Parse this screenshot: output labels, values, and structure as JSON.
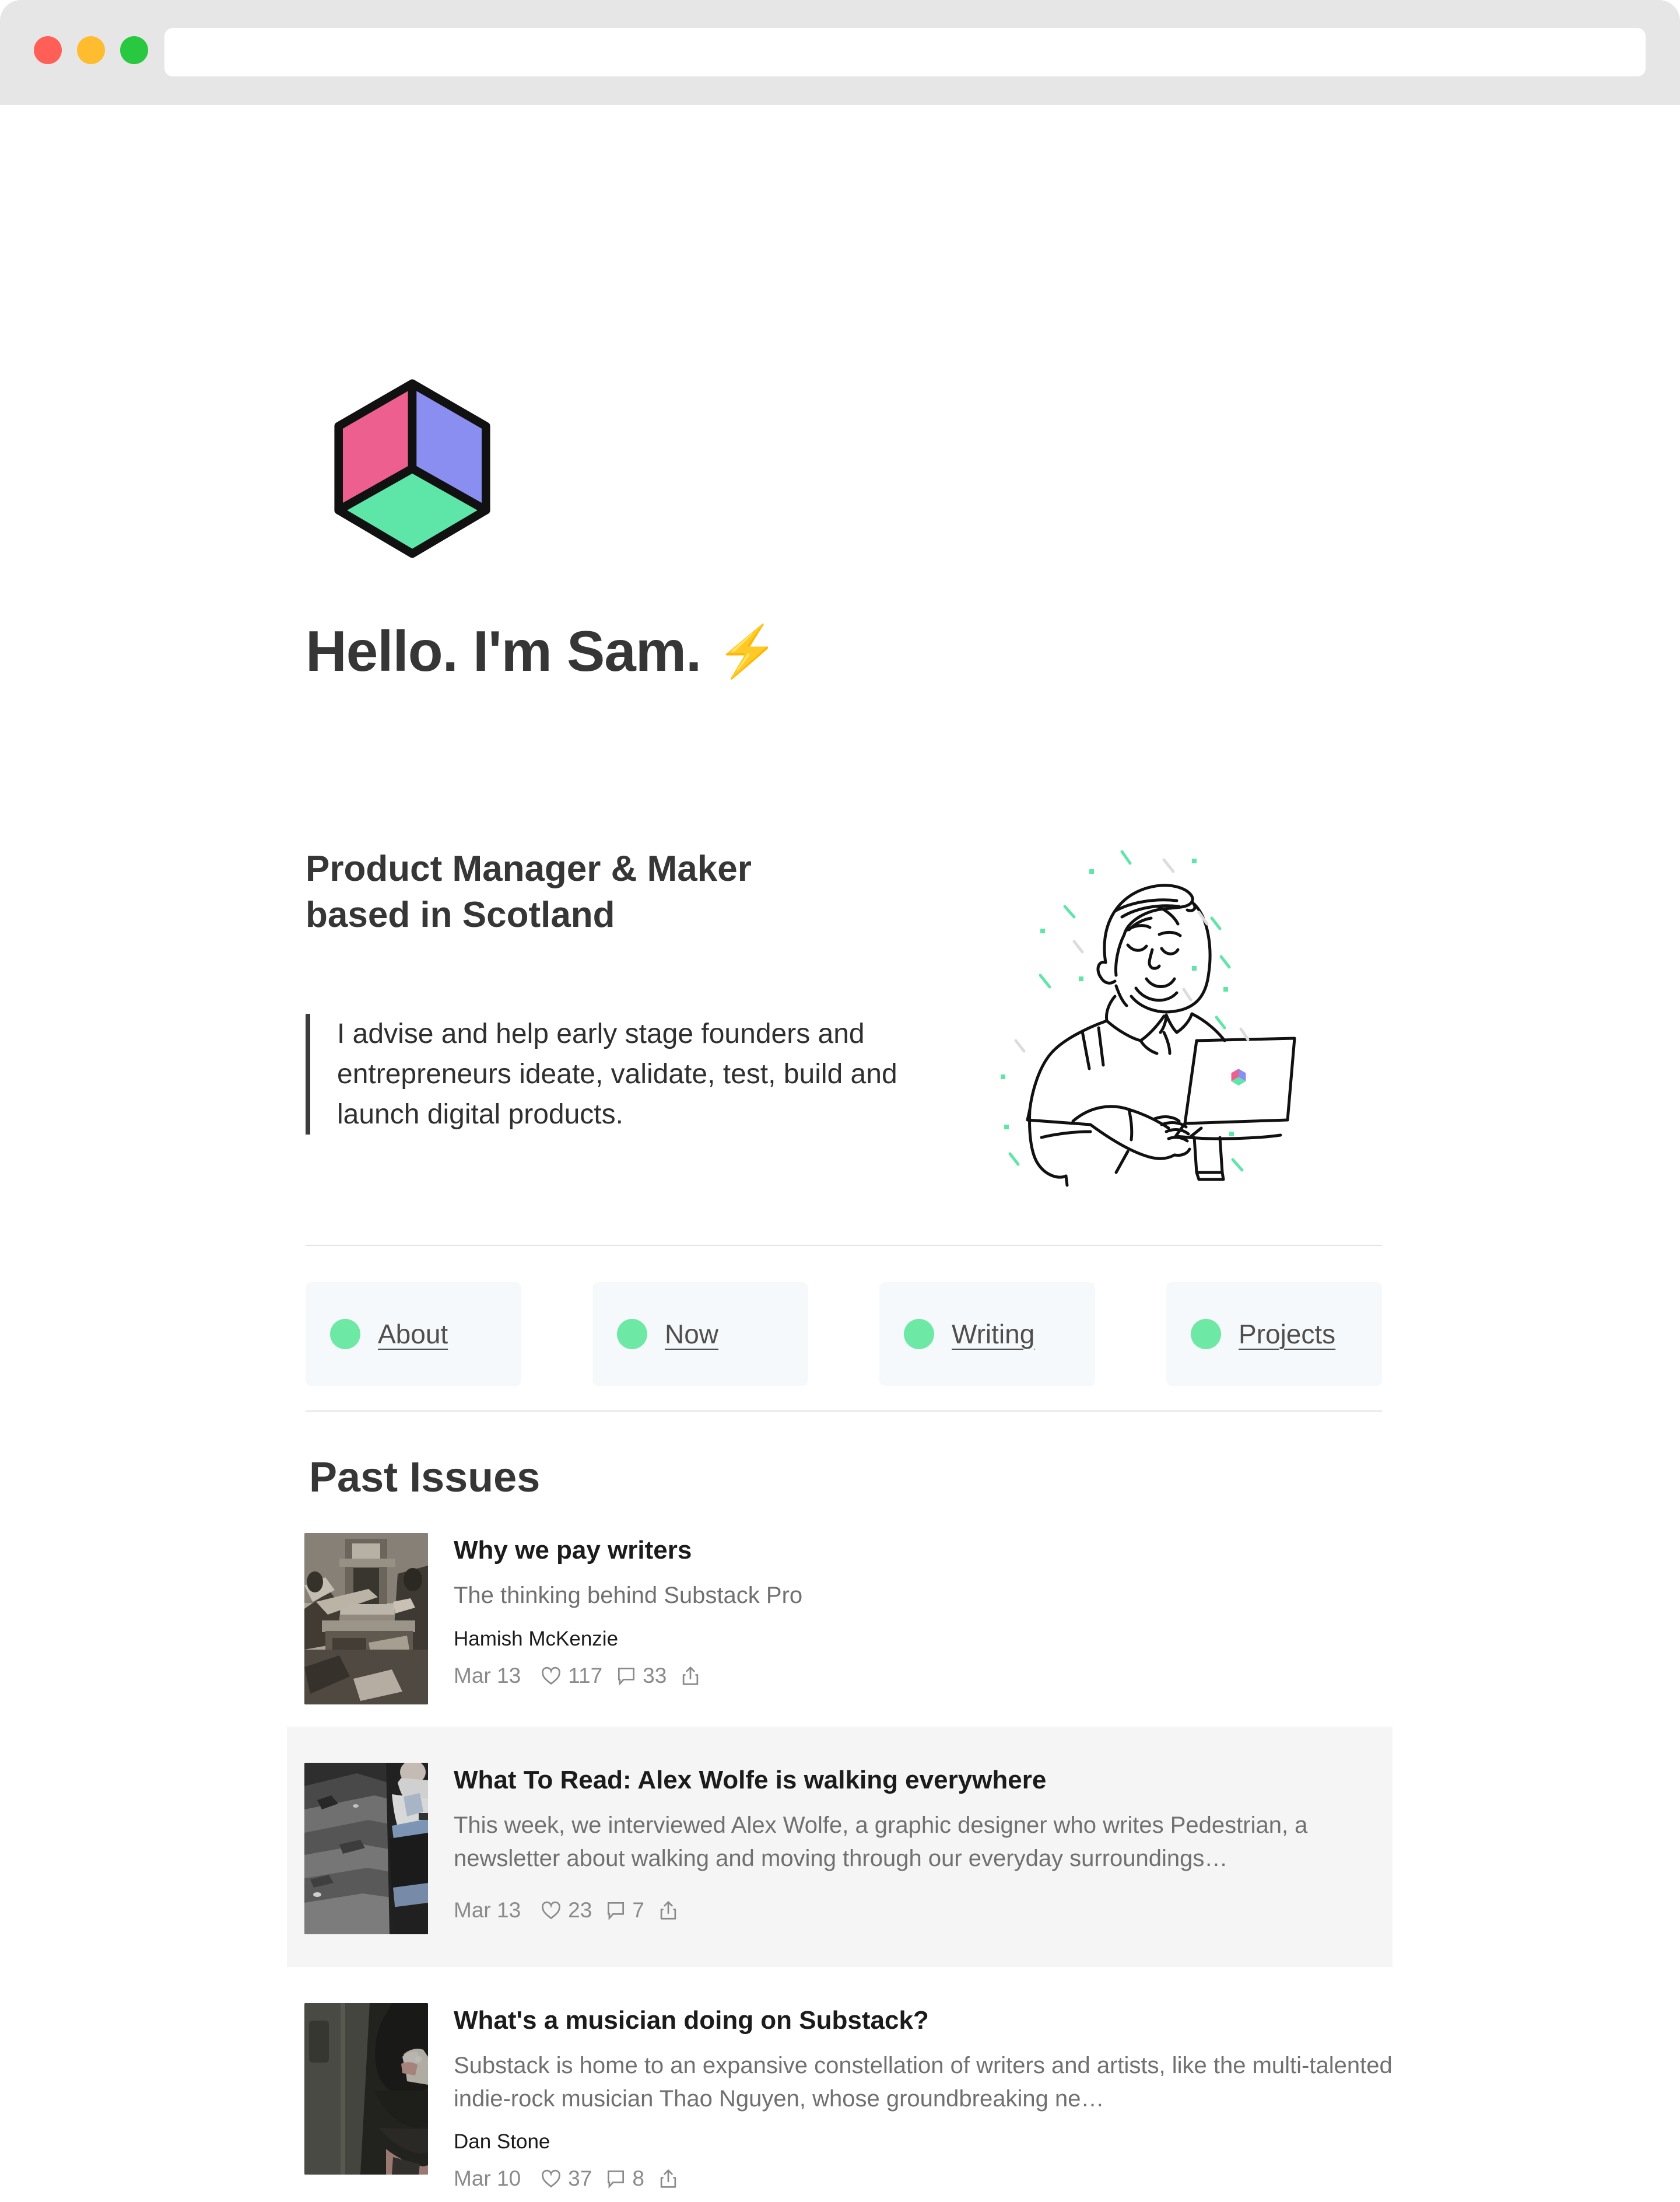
{
  "browser": {
    "traffic_lights": [
      "close",
      "minimize",
      "zoom"
    ],
    "url_value": "",
    "url_placeholder": ""
  },
  "hero": {
    "logo_name": "cube-logo",
    "logo_colors": {
      "left": "#ec5f8e",
      "right": "#8a8ef0",
      "bottom": "#5ee6a8",
      "outline": "#111111"
    },
    "headline": "Hello. I'm Sam.",
    "headline_emoji": "⚡",
    "subtitle_line1": "Product Manager & Maker",
    "subtitle_line2": "based in Scotland",
    "blockquote": "I advise and help early stage founders and entrepreneurs ideate, validate, test, build and launch digital products.",
    "illustration_name": "man-with-laptop-illustration",
    "banner_gradient": "#8fc4ae"
  },
  "nav": {
    "accent_color": "#6de8a5",
    "card_bg": "#f6f9fb",
    "items": [
      {
        "label": "About",
        "name": "nav-card-about"
      },
      {
        "label": "Now",
        "name": "nav-card-now"
      },
      {
        "label": "Writing",
        "name": "nav-card-writing"
      },
      {
        "label": "Projects",
        "name": "nav-card-projects"
      }
    ]
  },
  "past_issues": {
    "title": "Past Issues",
    "posts": [
      {
        "title": "Why we pay writers",
        "subtitle": "The thinking behind Substack Pro",
        "author": "Hamish McKenzie",
        "date": "Mar 13",
        "likes": "117",
        "comments": "33",
        "thumb_name": "printing-press-engraving-thumbnail",
        "highlighted": false
      },
      {
        "title": "What To Read: Alex Wolfe is walking everywhere",
        "subtitle": "This week, we interviewed Alex Wolfe, a graphic designer who writes Pedestrian, a newsletter about walking and moving through our everyday surroundings…",
        "author": "",
        "date": "Mar 13",
        "likes": "23",
        "comments": "7",
        "thumb_name": "person-on-rocks-photo-thumbnail",
        "highlighted": true
      },
      {
        "title": "What's a musician doing on Substack?",
        "subtitle": "Substack is home to an expansive constellation of writers and artists, like the multi-talented indie-rock musician Thao Nguyen, whose groundbreaking ne…",
        "author": "Dan Stone",
        "date": "Mar 10",
        "likes": "37",
        "comments": "8",
        "thumb_name": "dark-portrait-photo-thumbnail",
        "highlighted": false
      }
    ]
  }
}
